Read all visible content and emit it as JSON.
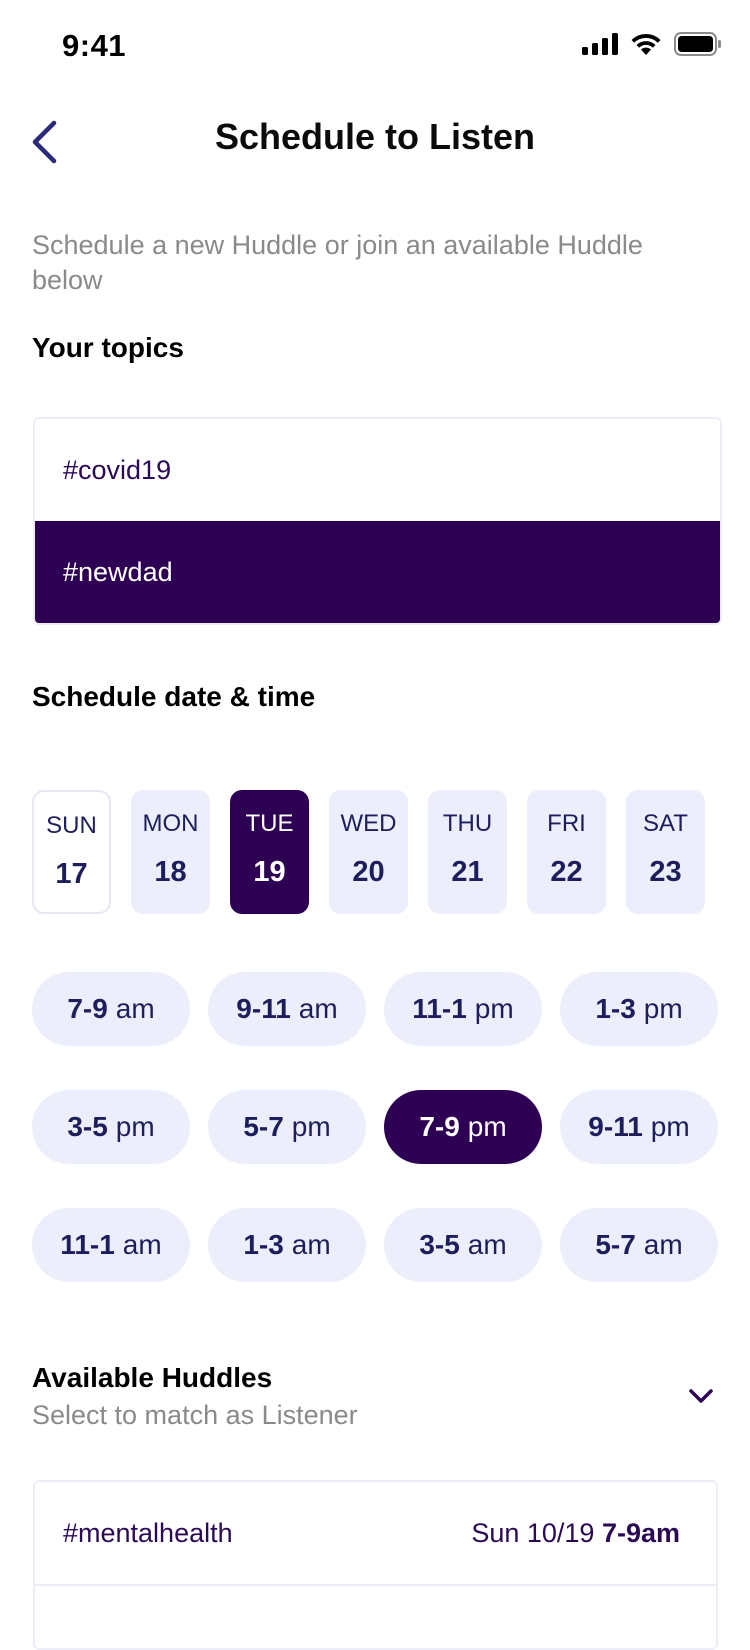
{
  "status": {
    "time": "9:41"
  },
  "header": {
    "title": "Schedule to Listen"
  },
  "intro": "Schedule a new Huddle or join an available Huddle below",
  "topics": {
    "heading": "Your topics",
    "items": [
      {
        "label": "#covid19",
        "selected": false
      },
      {
        "label": "#newdad",
        "selected": true
      }
    ]
  },
  "schedule": {
    "heading": "Schedule date & time",
    "days": [
      {
        "name": "SUN",
        "num": "17",
        "state": "outline"
      },
      {
        "name": "MON",
        "num": "18",
        "state": "normal"
      },
      {
        "name": "TUE",
        "num": "19",
        "state": "active"
      },
      {
        "name": "WED",
        "num": "20",
        "state": "normal"
      },
      {
        "name": "THU",
        "num": "21",
        "state": "normal"
      },
      {
        "name": "FRI",
        "num": "22",
        "state": "normal"
      },
      {
        "name": "SAT",
        "num": "23",
        "state": "normal"
      }
    ],
    "slots": [
      {
        "range": "7-9",
        "period": "am"
      },
      {
        "range": "9-11",
        "period": "am"
      },
      {
        "range": "11-1",
        "period": "pm"
      },
      {
        "range": "1-3",
        "period": "pm"
      },
      {
        "range": "3-5",
        "period": "pm"
      },
      {
        "range": "5-7",
        "period": "pm"
      },
      {
        "range": "7-9",
        "period": "pm",
        "active": true
      },
      {
        "range": "9-11",
        "period": "pm"
      },
      {
        "range": "11-1",
        "period": "am"
      },
      {
        "range": "1-3",
        "period": "am"
      },
      {
        "range": "3-5",
        "period": "am"
      },
      {
        "range": "5-7",
        "period": "am"
      }
    ]
  },
  "available": {
    "title": "Available Huddles",
    "subtitle": "Select to match as Listener",
    "items": [
      {
        "tag": "#mentalhealth",
        "date": "Sun 10/19",
        "time": "7-9am"
      }
    ]
  },
  "colors": {
    "accent": "#2d0054",
    "chip": "#eceefb",
    "chip_text": "#1e1e5c"
  }
}
